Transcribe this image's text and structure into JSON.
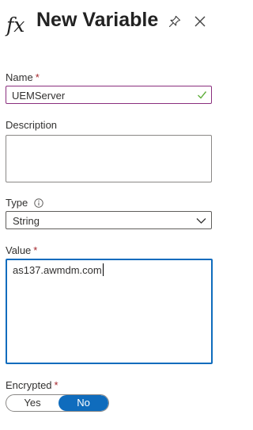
{
  "header": {
    "icon": "fx-icon",
    "title": "New Variable"
  },
  "form": {
    "name": {
      "label": "Name",
      "required_mark": "*",
      "value": "UEMServer",
      "valid": true
    },
    "description": {
      "label": "Description",
      "value": ""
    },
    "type": {
      "label": "Type",
      "selected": "String"
    },
    "value": {
      "label": "Value",
      "required_mark": "*",
      "value": "as137.awmdm.com"
    },
    "encrypted": {
      "label": "Encrypted",
      "required_mark": "*",
      "options": [
        "Yes",
        "No"
      ],
      "selected": "No"
    }
  },
  "colors": {
    "accent": "#0f6cbd",
    "name_border": "#8a2f7e",
    "valid_check": "#5fae3b",
    "required": "#a4262c"
  }
}
